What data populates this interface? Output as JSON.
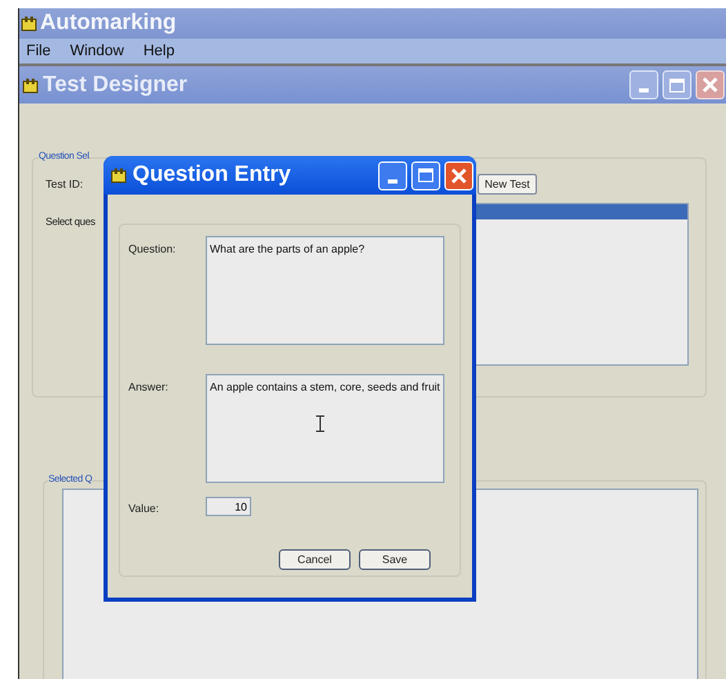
{
  "app": {
    "title": "Automarking"
  },
  "menu": [
    "File",
    "Window",
    "Help"
  ],
  "child_window": {
    "title": "Test Designer",
    "question_selection": {
      "legend": "Question Sel",
      "test_id_label": "Test ID:",
      "select_label": "Select ques",
      "new_test_button": "New Test",
      "list_rows": [
        {
          "selected": true
        }
      ]
    },
    "selected_questions": {
      "legend": "Selected Q"
    }
  },
  "dialog": {
    "title": "Question Entry",
    "fields": [
      {
        "label": "Question:",
        "value": "What are the parts of an apple?"
      },
      {
        "label": "Answer:",
        "value": "An apple contains a stem, core, seeds and fruit"
      }
    ],
    "value_field": {
      "label": "Value:",
      "value": "10"
    },
    "buttons": [
      "Cancel",
      "Save"
    ]
  }
}
